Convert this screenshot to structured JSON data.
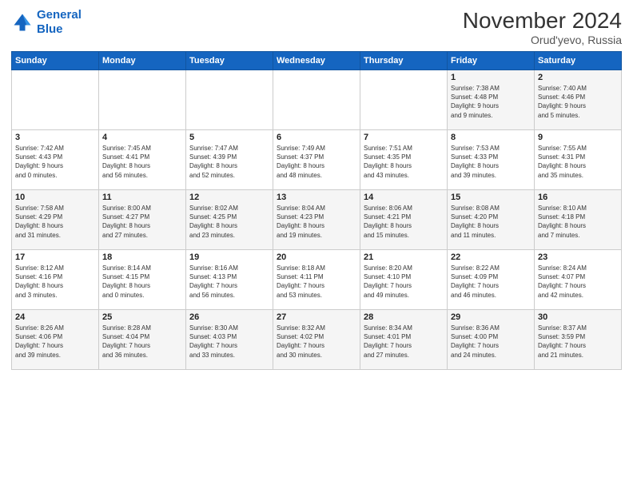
{
  "logo": {
    "line1": "General",
    "line2": "Blue"
  },
  "title": "November 2024",
  "location": "Orud'yevo, Russia",
  "days_header": [
    "Sunday",
    "Monday",
    "Tuesday",
    "Wednesday",
    "Thursday",
    "Friday",
    "Saturday"
  ],
  "weeks": [
    [
      {
        "day": "",
        "info": ""
      },
      {
        "day": "",
        "info": ""
      },
      {
        "day": "",
        "info": ""
      },
      {
        "day": "",
        "info": ""
      },
      {
        "day": "",
        "info": ""
      },
      {
        "day": "1",
        "info": "Sunrise: 7:38 AM\nSunset: 4:48 PM\nDaylight: 9 hours\nand 9 minutes."
      },
      {
        "day": "2",
        "info": "Sunrise: 7:40 AM\nSunset: 4:46 PM\nDaylight: 9 hours\nand 5 minutes."
      }
    ],
    [
      {
        "day": "3",
        "info": "Sunrise: 7:42 AM\nSunset: 4:43 PM\nDaylight: 9 hours\nand 0 minutes."
      },
      {
        "day": "4",
        "info": "Sunrise: 7:45 AM\nSunset: 4:41 PM\nDaylight: 8 hours\nand 56 minutes."
      },
      {
        "day": "5",
        "info": "Sunrise: 7:47 AM\nSunset: 4:39 PM\nDaylight: 8 hours\nand 52 minutes."
      },
      {
        "day": "6",
        "info": "Sunrise: 7:49 AM\nSunset: 4:37 PM\nDaylight: 8 hours\nand 48 minutes."
      },
      {
        "day": "7",
        "info": "Sunrise: 7:51 AM\nSunset: 4:35 PM\nDaylight: 8 hours\nand 43 minutes."
      },
      {
        "day": "8",
        "info": "Sunrise: 7:53 AM\nSunset: 4:33 PM\nDaylight: 8 hours\nand 39 minutes."
      },
      {
        "day": "9",
        "info": "Sunrise: 7:55 AM\nSunset: 4:31 PM\nDaylight: 8 hours\nand 35 minutes."
      }
    ],
    [
      {
        "day": "10",
        "info": "Sunrise: 7:58 AM\nSunset: 4:29 PM\nDaylight: 8 hours\nand 31 minutes."
      },
      {
        "day": "11",
        "info": "Sunrise: 8:00 AM\nSunset: 4:27 PM\nDaylight: 8 hours\nand 27 minutes."
      },
      {
        "day": "12",
        "info": "Sunrise: 8:02 AM\nSunset: 4:25 PM\nDaylight: 8 hours\nand 23 minutes."
      },
      {
        "day": "13",
        "info": "Sunrise: 8:04 AM\nSunset: 4:23 PM\nDaylight: 8 hours\nand 19 minutes."
      },
      {
        "day": "14",
        "info": "Sunrise: 8:06 AM\nSunset: 4:21 PM\nDaylight: 8 hours\nand 15 minutes."
      },
      {
        "day": "15",
        "info": "Sunrise: 8:08 AM\nSunset: 4:20 PM\nDaylight: 8 hours\nand 11 minutes."
      },
      {
        "day": "16",
        "info": "Sunrise: 8:10 AM\nSunset: 4:18 PM\nDaylight: 8 hours\nand 7 minutes."
      }
    ],
    [
      {
        "day": "17",
        "info": "Sunrise: 8:12 AM\nSunset: 4:16 PM\nDaylight: 8 hours\nand 3 minutes."
      },
      {
        "day": "18",
        "info": "Sunrise: 8:14 AM\nSunset: 4:15 PM\nDaylight: 8 hours\nand 0 minutes."
      },
      {
        "day": "19",
        "info": "Sunrise: 8:16 AM\nSunset: 4:13 PM\nDaylight: 7 hours\nand 56 minutes."
      },
      {
        "day": "20",
        "info": "Sunrise: 8:18 AM\nSunset: 4:11 PM\nDaylight: 7 hours\nand 53 minutes."
      },
      {
        "day": "21",
        "info": "Sunrise: 8:20 AM\nSunset: 4:10 PM\nDaylight: 7 hours\nand 49 minutes."
      },
      {
        "day": "22",
        "info": "Sunrise: 8:22 AM\nSunset: 4:09 PM\nDaylight: 7 hours\nand 46 minutes."
      },
      {
        "day": "23",
        "info": "Sunrise: 8:24 AM\nSunset: 4:07 PM\nDaylight: 7 hours\nand 42 minutes."
      }
    ],
    [
      {
        "day": "24",
        "info": "Sunrise: 8:26 AM\nSunset: 4:06 PM\nDaylight: 7 hours\nand 39 minutes."
      },
      {
        "day": "25",
        "info": "Sunrise: 8:28 AM\nSunset: 4:04 PM\nDaylight: 7 hours\nand 36 minutes."
      },
      {
        "day": "26",
        "info": "Sunrise: 8:30 AM\nSunset: 4:03 PM\nDaylight: 7 hours\nand 33 minutes."
      },
      {
        "day": "27",
        "info": "Sunrise: 8:32 AM\nSunset: 4:02 PM\nDaylight: 7 hours\nand 30 minutes."
      },
      {
        "day": "28",
        "info": "Sunrise: 8:34 AM\nSunset: 4:01 PM\nDaylight: 7 hours\nand 27 minutes."
      },
      {
        "day": "29",
        "info": "Sunrise: 8:36 AM\nSunset: 4:00 PM\nDaylight: 7 hours\nand 24 minutes."
      },
      {
        "day": "30",
        "info": "Sunrise: 8:37 AM\nSunset: 3:59 PM\nDaylight: 7 hours\nand 21 minutes."
      }
    ]
  ]
}
